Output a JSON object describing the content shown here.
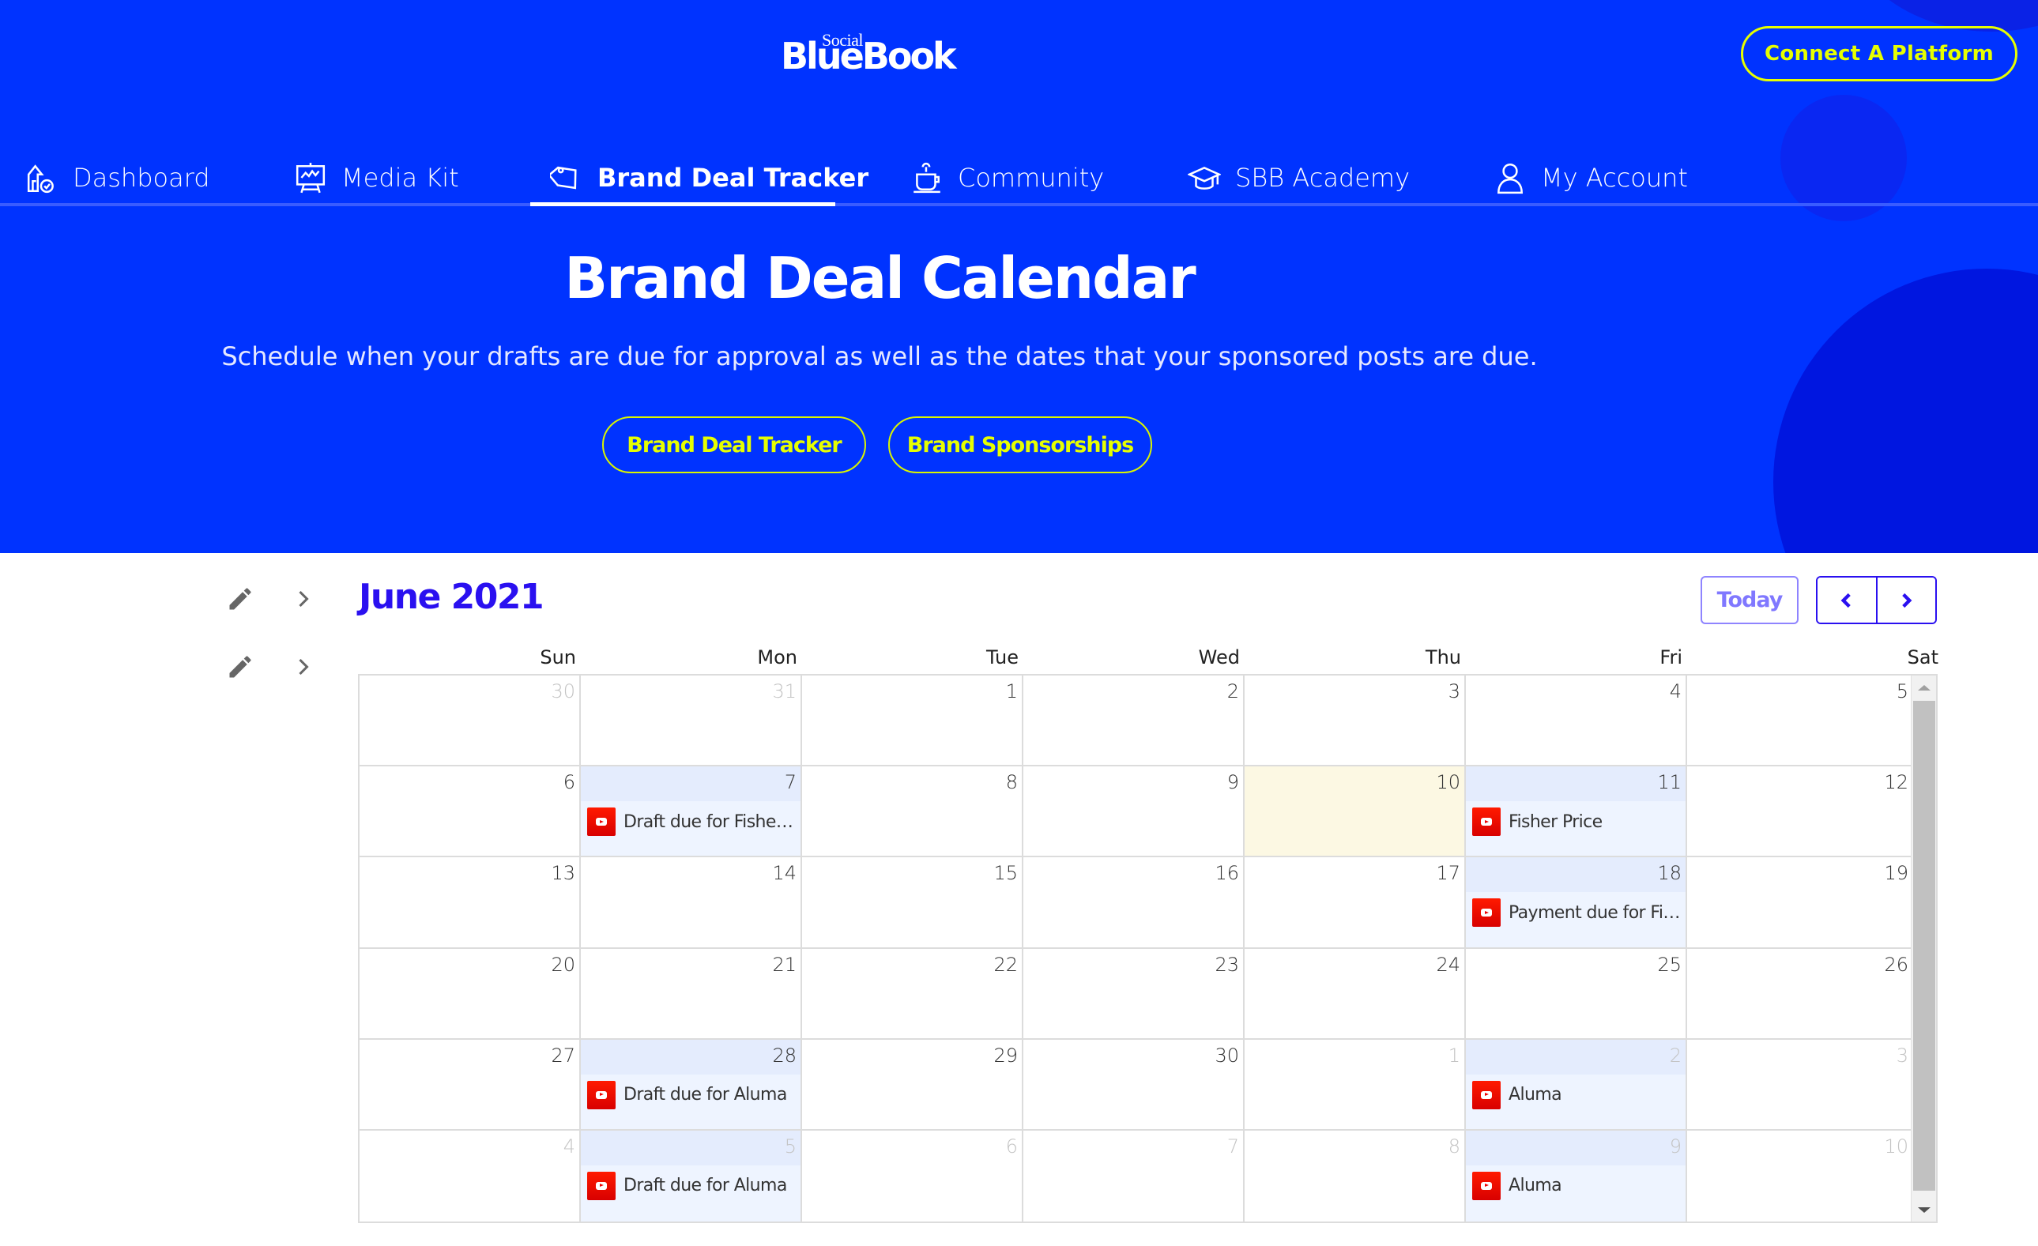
{
  "header": {
    "logo_small": "Social",
    "logo_main": "BlueBook",
    "connect_button": "Connect A Platform"
  },
  "nav": {
    "items": [
      {
        "label": "Dashboard",
        "icon": "dashboard-icon"
      },
      {
        "label": "Media Kit",
        "icon": "presentation-board-icon"
      },
      {
        "label": "Brand Deal Tracker",
        "icon": "tag-icon",
        "active": true
      },
      {
        "label": "Community",
        "icon": "coffee-cup-icon"
      },
      {
        "label": "SBB Academy",
        "icon": "graduation-cap-icon"
      },
      {
        "label": "My Account",
        "icon": "user-icon"
      }
    ]
  },
  "hero": {
    "title": "Brand Deal Calendar",
    "subtitle": "Schedule when your drafts are due for approval as well as the dates that your sponsored posts are due.",
    "buttons": [
      "Brand Deal Tracker",
      "Brand Sponsorships"
    ]
  },
  "calendar": {
    "month_title": "June 2021",
    "today_label": "Today",
    "days_of_week": [
      "Sun",
      "Mon",
      "Tue",
      "Wed",
      "Thu",
      "Fri",
      "Sat"
    ],
    "today_date": 10,
    "weeks": [
      [
        {
          "d": "30",
          "other": true
        },
        {
          "d": "31",
          "other": true
        },
        {
          "d": "1"
        },
        {
          "d": "2"
        },
        {
          "d": "3"
        },
        {
          "d": "4"
        },
        {
          "d": "5"
        }
      ],
      [
        {
          "d": "6"
        },
        {
          "d": "7",
          "event": "Draft due for Fisher Price"
        },
        {
          "d": "8"
        },
        {
          "d": "9"
        },
        {
          "d": "10",
          "today": true
        },
        {
          "d": "11",
          "event": "Fisher Price"
        },
        {
          "d": "12"
        }
      ],
      [
        {
          "d": "13"
        },
        {
          "d": "14"
        },
        {
          "d": "15"
        },
        {
          "d": "16"
        },
        {
          "d": "17"
        },
        {
          "d": "18",
          "event": "Payment due for Fisher Price"
        },
        {
          "d": "19"
        }
      ],
      [
        {
          "d": "20"
        },
        {
          "d": "21"
        },
        {
          "d": "22"
        },
        {
          "d": "23"
        },
        {
          "d": "24"
        },
        {
          "d": "25"
        },
        {
          "d": "26"
        }
      ],
      [
        {
          "d": "27"
        },
        {
          "d": "28",
          "event": "Draft due for Aluma"
        },
        {
          "d": "29"
        },
        {
          "d": "30"
        },
        {
          "d": "1",
          "other": true
        },
        {
          "d": "2",
          "other": true,
          "event": "Aluma"
        },
        {
          "d": "3",
          "other": true
        }
      ],
      [
        {
          "d": "4",
          "other": true
        },
        {
          "d": "5",
          "other": true,
          "event": "Draft due for Aluma"
        },
        {
          "d": "6",
          "other": true
        },
        {
          "d": "7",
          "other": true
        },
        {
          "d": "8",
          "other": true
        },
        {
          "d": "9",
          "other": true,
          "event": "Aluma"
        },
        {
          "d": "10",
          "other": true
        }
      ]
    ],
    "event_icon": "youtube-icon"
  },
  "colors": {
    "hero_bg": "#0033ff",
    "accent_yellow": "#e6ff00",
    "month_title": "#2a10f0",
    "today_cell": "#fcf8e3",
    "event_cell": "#eef4ff",
    "youtube_red": "#e00000"
  }
}
